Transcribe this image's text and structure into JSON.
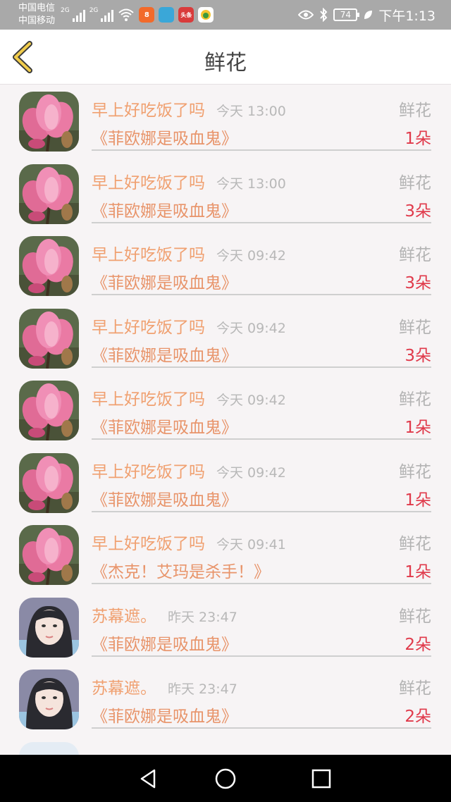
{
  "status_bar": {
    "carrier1": "中国电信",
    "carrier2": "中国移动",
    "net1": "2G",
    "net2": "2G",
    "app_icon_1": "8",
    "app_icon_3": "头条",
    "battery": "74",
    "time": "下午1:13"
  },
  "header": {
    "title": "鲜花"
  },
  "rows": [
    {
      "sender": "早上好吃饭了吗",
      "time": "今天 13:00",
      "gift": "鲜花",
      "book": "《菲欧娜是吸血鬼》",
      "count": "1朵",
      "avatar": "flower"
    },
    {
      "sender": "早上好吃饭了吗",
      "time": "今天 13:00",
      "gift": "鲜花",
      "book": "《菲欧娜是吸血鬼》",
      "count": "3朵",
      "avatar": "flower"
    },
    {
      "sender": "早上好吃饭了吗",
      "time": "今天 09:42",
      "gift": "鲜花",
      "book": "《菲欧娜是吸血鬼》",
      "count": "3朵",
      "avatar": "flower"
    },
    {
      "sender": "早上好吃饭了吗",
      "time": "今天 09:42",
      "gift": "鲜花",
      "book": "《菲欧娜是吸血鬼》",
      "count": "3朵",
      "avatar": "flower"
    },
    {
      "sender": "早上好吃饭了吗",
      "time": "今天 09:42",
      "gift": "鲜花",
      "book": "《菲欧娜是吸血鬼》",
      "count": "1朵",
      "avatar": "flower"
    },
    {
      "sender": "早上好吃饭了吗",
      "time": "今天 09:42",
      "gift": "鲜花",
      "book": "《菲欧娜是吸血鬼》",
      "count": "1朵",
      "avatar": "flower"
    },
    {
      "sender": "早上好吃饭了吗",
      "time": "今天 09:41",
      "gift": "鲜花",
      "book": "《杰克！艾玛是杀手！》",
      "count": "1朵",
      "avatar": "flower"
    },
    {
      "sender": "苏幕遮。",
      "time": "昨天 23:47",
      "gift": "鲜花",
      "book": "《菲欧娜是吸血鬼》",
      "count": "2朵",
      "avatar": "person"
    },
    {
      "sender": "苏幕遮。",
      "time": "昨天 23:47",
      "gift": "鲜花",
      "book": "《菲欧娜是吸血鬼》",
      "count": "2朵",
      "avatar": "person"
    }
  ],
  "icons": {
    "back": "back-chevron-icon",
    "nav_back": "nav-back-icon",
    "nav_home": "nav-home-icon",
    "nav_recents": "nav-recents-icon"
  },
  "colors": {
    "sender": "#f0a070",
    "book": "#e8946a",
    "count": "#e0394a",
    "back_arrow": "#e8c14a"
  }
}
